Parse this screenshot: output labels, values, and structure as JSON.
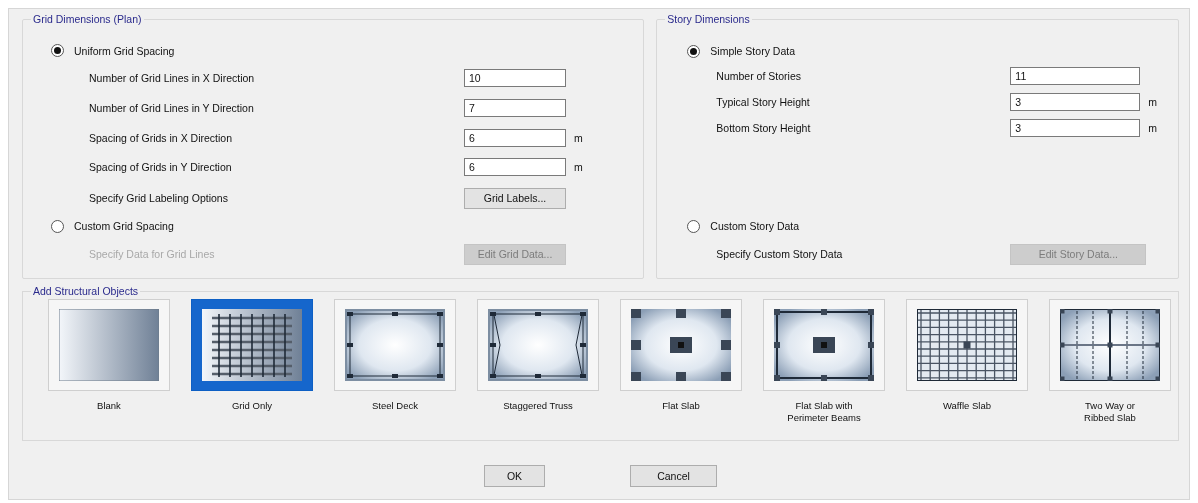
{
  "grid_dimensions": {
    "title": "Grid Dimensions (Plan)",
    "uniform": {
      "label": "Uniform Grid Spacing",
      "selected": true
    },
    "fields": [
      {
        "label": "Number of Grid Lines in X Direction",
        "value": "10"
      },
      {
        "label": "Number of Grid Lines in Y Direction",
        "value": "7"
      },
      {
        "label": "Spacing of Grids in X Direction",
        "value": "6",
        "unit": "m"
      },
      {
        "label": "Spacing of Grids in Y Direction",
        "value": "6",
        "unit": "m"
      }
    ],
    "labeling": {
      "label": "Specify Grid Labeling Options",
      "button": "Grid Labels..."
    },
    "custom": {
      "label": "Custom Grid Spacing",
      "selected": false
    },
    "custom_row": {
      "label": "Specify Data for Grid Lines",
      "label_disabled": true,
      "button": "Edit Grid Data...",
      "button_disabled": true
    }
  },
  "story_dimensions": {
    "title": "Story Dimensions",
    "simple": {
      "label": "Simple Story Data",
      "selected": true
    },
    "fields": [
      {
        "label": "Number of Stories",
        "value": "11"
      },
      {
        "label": "Typical Story Height",
        "value": "3",
        "unit": "m"
      },
      {
        "label": "Bottom Story Height",
        "value": "3",
        "unit": "m"
      }
    ],
    "custom": {
      "label": "Custom Story Data",
      "selected": false
    },
    "custom_row": {
      "label": "Specify Custom Story Data",
      "label_disabled": false,
      "button": "Edit Story Data...",
      "button_disabled": true
    }
  },
  "structural_objects": {
    "title": "Add Structural Objects",
    "items": [
      {
        "label": "Blank",
        "kind": "blank",
        "selected": false
      },
      {
        "label": "Grid Only",
        "kind": "grid",
        "selected": true
      },
      {
        "label": "Steel Deck",
        "kind": "steel_deck",
        "selected": false
      },
      {
        "label": "Staggered Truss",
        "kind": "staggered_truss",
        "selected": false
      },
      {
        "label": "Flat Slab",
        "kind": "flat_slab",
        "selected": false
      },
      {
        "label": "Flat Slab with\nPerimeter Beams",
        "kind": "flat_slab_beams",
        "selected": false
      },
      {
        "label": "Waffle Slab",
        "kind": "waffle",
        "selected": false
      },
      {
        "label": "Two Way or\nRibbed Slab",
        "kind": "two_way",
        "selected": false
      }
    ]
  },
  "buttons": [
    "OK",
    "Cancel"
  ]
}
